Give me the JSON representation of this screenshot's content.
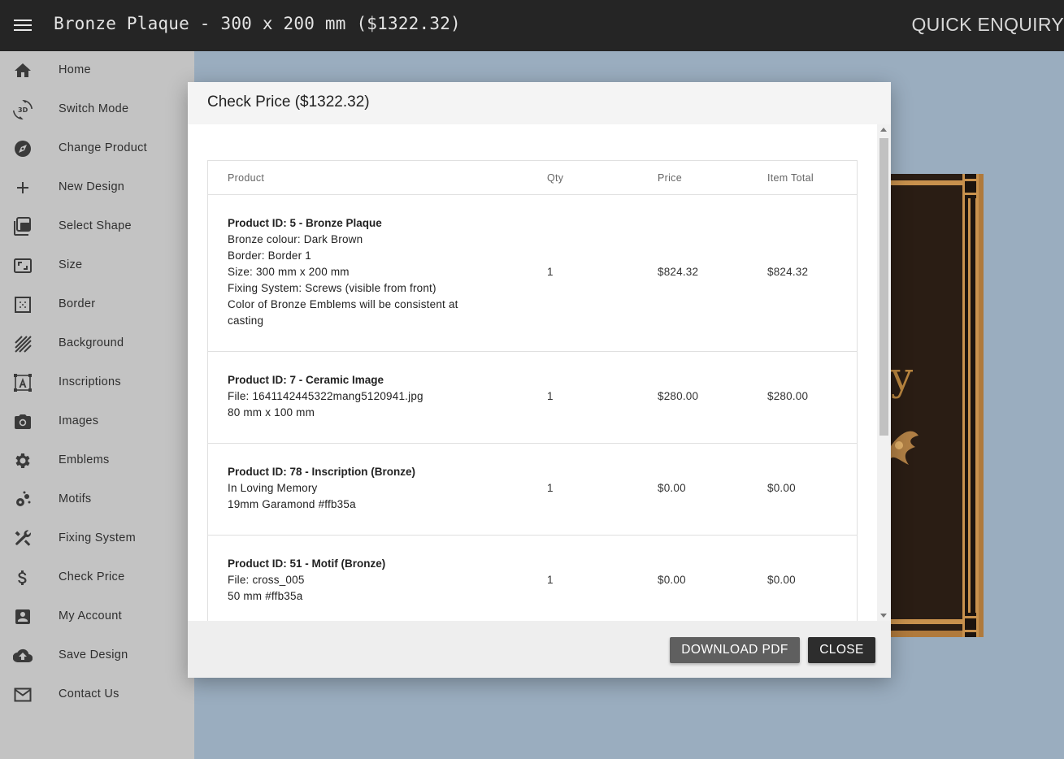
{
  "header": {
    "title": "Bronze Plaque - 300 x 200 mm ($1322.32)",
    "quick_enquiry": "QUICK ENQUIRY"
  },
  "sidebar": {
    "items": [
      {
        "label": "Home",
        "icon": "home-icon"
      },
      {
        "label": "Switch Mode",
        "icon": "3d-rotate-icon"
      },
      {
        "label": "Change Product",
        "icon": "compass-icon"
      },
      {
        "label": "New Design",
        "icon": "plus-icon"
      },
      {
        "label": "Select Shape",
        "icon": "layers-icon"
      },
      {
        "label": "Size",
        "icon": "resize-icon"
      },
      {
        "label": "Border",
        "icon": "border-icon"
      },
      {
        "label": "Background",
        "icon": "texture-icon"
      },
      {
        "label": "Inscriptions",
        "icon": "text-box-icon"
      },
      {
        "label": "Images",
        "icon": "camera-icon"
      },
      {
        "label": "Emblems",
        "icon": "gear-icon"
      },
      {
        "label": "Motifs",
        "icon": "motif-icon"
      },
      {
        "label": "Fixing System",
        "icon": "tools-icon"
      },
      {
        "label": "Check Price",
        "icon": "dollar-icon"
      },
      {
        "label": "My Account",
        "icon": "account-box-icon"
      },
      {
        "label": "Save Design",
        "icon": "cloud-upload-icon"
      },
      {
        "label": "Contact Us",
        "icon": "mail-icon"
      }
    ]
  },
  "canvas": {
    "plaque_text": "y"
  },
  "modal": {
    "title": "Check Price ($1322.32)",
    "columns": {
      "product": "Product",
      "qty": "Qty",
      "price": "Price",
      "total": "Item Total"
    },
    "rows": [
      {
        "title": "Product ID: 5 - Bronze Plaque",
        "lines": [
          "Bronze colour: Dark Brown",
          "Border: Border 1",
          "Size: 300 mm x 200 mm",
          "Fixing System: Screws (visible from front)",
          "Color of Bronze Emblems will be consistent at casting"
        ],
        "qty": "1",
        "price": "$824.32",
        "total": "$824.32"
      },
      {
        "title": "Product ID: 7 - Ceramic Image",
        "lines": [
          "File: 1641142445322mang5120941.jpg",
          "80 mm x 100 mm"
        ],
        "qty": "1",
        "price": "$280.00",
        "total": "$280.00"
      },
      {
        "title": "Product ID: 78 - Inscription (Bronze)",
        "lines": [
          "In Loving Memory",
          "19mm Garamond #ffb35a"
        ],
        "qty": "1",
        "price": "$0.00",
        "total": "$0.00"
      },
      {
        "title": "Product ID: 51 - Motif (Bronze)",
        "lines": [
          "File: cross_005",
          "50 mm #ffb35a"
        ],
        "qty": "1",
        "price": "$0.00",
        "total": "$0.00"
      }
    ],
    "buttons": {
      "download": "DOWNLOAD PDF",
      "close": "CLOSE"
    }
  },
  "colors": {
    "topbar": "#252525",
    "sidebar": "#c3c3c3",
    "canvas_bg": "#9aadbf",
    "bronze": "#c8914d",
    "button_dark": "#2d2d2d",
    "button_gray": "#5f5f5f"
  }
}
